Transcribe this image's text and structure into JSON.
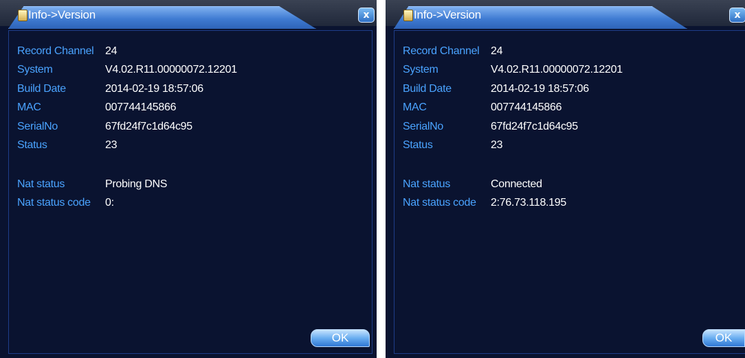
{
  "panels": [
    {
      "title": "Info->Version",
      "close_label": "x",
      "fields": [
        {
          "label": "Record Channel",
          "value": "24"
        },
        {
          "label": "System",
          "value": "V4.02.R11.00000072.12201"
        },
        {
          "label": "Build Date",
          "value": "2014-02-19 18:57:06"
        },
        {
          "label": "MAC",
          "value": "007744145866"
        },
        {
          "label": "SerialNo",
          "value": "67fd24f7c1d64c95"
        },
        {
          "label": "Status",
          "value": "23"
        }
      ],
      "nat": [
        {
          "label": "Nat status",
          "value": "Probing DNS"
        },
        {
          "label": "Nat status code",
          "value": "0:"
        }
      ],
      "ok_label": "OK"
    },
    {
      "title": "Info->Version",
      "close_label": "x",
      "fields": [
        {
          "label": "Record Channel",
          "value": "24"
        },
        {
          "label": "System",
          "value": "V4.02.R11.00000072.12201"
        },
        {
          "label": "Build Date",
          "value": "2014-02-19 18:57:06"
        },
        {
          "label": "MAC",
          "value": "007744145866"
        },
        {
          "label": "SerialNo",
          "value": "67fd24f7c1d64c95"
        },
        {
          "label": "Status",
          "value": "23"
        }
      ],
      "nat": [
        {
          "label": "Nat status",
          "value": "Connected"
        },
        {
          "label": "Nat status code",
          "value": "2:76.73.118.195"
        }
      ],
      "ok_label": "OK"
    }
  ]
}
